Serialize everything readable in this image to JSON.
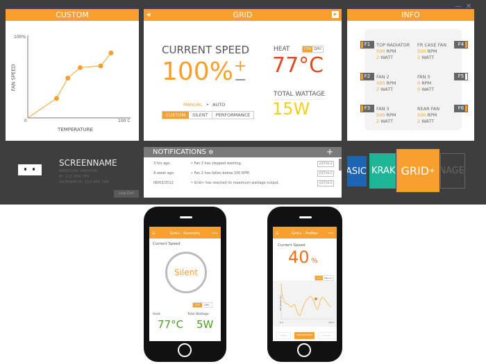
{
  "window": {
    "minimize": "—",
    "close": "✕"
  },
  "custom": {
    "title": "CUSTOM",
    "chart_data": {
      "type": "line",
      "xlabel": "TEMPERATURE",
      "ylabel": "FAN SPEED",
      "x_ticks": [
        "0",
        "100 C"
      ],
      "y_ticks": [
        "100%"
      ],
      "xlim": [
        0,
        100
      ],
      "ylim": [
        0,
        100
      ],
      "x": [
        0,
        28,
        39,
        51,
        71,
        81
      ],
      "y": [
        0,
        24,
        49,
        62,
        64,
        80
      ],
      "color": "#f7a030"
    }
  },
  "grid": {
    "title": "GRID",
    "current_speed_label": "CURRENT SPEED",
    "speed": "100%",
    "plus": "+",
    "minus": "−",
    "mode_manual": "MANUAL",
    "mode_dot": "•",
    "mode_auto": "AUTO",
    "profiles": [
      "CUSTOM",
      "SILENT",
      "PERFORMANCE"
    ],
    "heat_label": "HEAT",
    "cpu": "CPU",
    "gpu": "GPU",
    "heat": "77°C",
    "wattage_label": "TOTAL WATTAGE",
    "wattage": "15W"
  },
  "info": {
    "title": "INFO",
    "fans": [
      {
        "tag": "F1",
        "name": "TOP RADIATOR",
        "rpm": "500",
        "rpm_unit": "RPM",
        "watt": "2",
        "watt_unit": "WATT"
      },
      {
        "tag": "F4",
        "name": "FR CASE FAN",
        "rpm": "500",
        "rpm_unit": "RPM",
        "watt": "2",
        "watt_unit": "WATT"
      },
      {
        "tag": "F2",
        "name": "FAN 2",
        "rpm": "500",
        "rpm_unit": "RPM",
        "watt": "2",
        "watt_unit": "WATT"
      },
      {
        "tag": "F5",
        "name": "FAN 5",
        "rpm": "0",
        "rpm_unit": "RPM",
        "watt": "0",
        "watt_unit": "WATT"
      },
      {
        "tag": "F3",
        "name": "FAN 3",
        "rpm": "500",
        "rpm_unit": "RPM",
        "watt": "2",
        "watt_unit": "WATT"
      },
      {
        "tag": "F6",
        "name": "REAR FAN",
        "rpm": "500",
        "rpm_unit": "RPM",
        "watt": "2",
        "watt_unit": "WATT"
      }
    ]
  },
  "user": {
    "screenname": "SCREENNAME",
    "os": "WINDOWS VERSION",
    "ip": "IP: 123.456.789",
    "gateway": "GATEWAY IP: 123.456.789",
    "logout": "Log Out"
  },
  "notifications": {
    "title": "NOTIFICATIONS",
    "add": "+",
    "items": [
      {
        "time": "3 hrs ago",
        "text": "• Fan 2 has stopped working.",
        "action": "DETAILS"
      },
      {
        "time": "A week ago",
        "text": "• Fan 2 has fallen below 200 RPM.",
        "action": "DETAILS"
      },
      {
        "time": "08/03/2012",
        "text": "• Grid+ has reached its maximum wattage output.",
        "action": "DETAILS"
      }
    ]
  },
  "apps": {
    "basic": "ASIC",
    "kraken": "KRAKE",
    "grid": "GRID",
    "grid_sup": "+",
    "manage": "ANAGE",
    "colors": {
      "basic": "#1e64b4",
      "kraken": "#1eb496",
      "grid": "#f7a030"
    }
  },
  "phone1": {
    "title": "Grid+ - Summary",
    "speed_label": "Current Speed",
    "mode": "Silent",
    "cpu": "CPU",
    "gpu": "GPU",
    "heat_label": "Heat",
    "wattage_label": "Total Wattage",
    "heat": "77°C",
    "wattage": "5W"
  },
  "phone2": {
    "title": "Grid+ - Profiles",
    "speed_label": "Current Speed",
    "speed": "40",
    "unit": "%",
    "auto": "Auto",
    "manual": "Manual",
    "ylabel": "Fan Speed (%)",
    "x0": "0 C",
    "x1": "100 C",
    "profiles": [
      "SILENT",
      "PERFORMANCE",
      "CUSTOM"
    ]
  }
}
